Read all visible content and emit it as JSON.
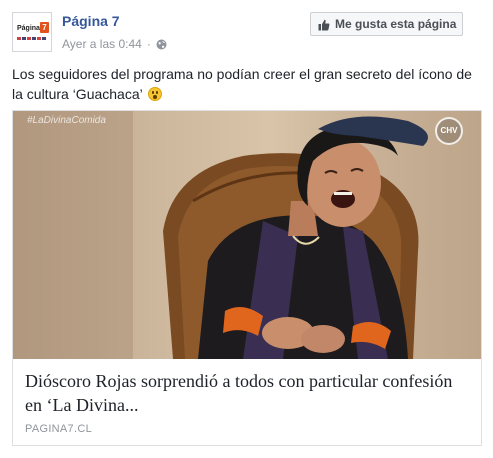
{
  "header": {
    "page_name": "Página 7",
    "timestamp": "Ayer a las 0:44",
    "separator": "·",
    "audience_icon": "globe-icon",
    "avatar_text": "Página",
    "avatar_badge": "7"
  },
  "like_button": {
    "label": "Me gusta esta página",
    "icon": "thumbs-up-icon"
  },
  "post": {
    "text": "Los seguidores del programa no podían creer el gran secreto del ícono de la cultura ‘Guachaca’",
    "emoji": "astonished-face-icon"
  },
  "link_card": {
    "watermark": "#LaDivinaComida",
    "channel_logo": "CHV",
    "title": "Dióscoro Rojas sorprendió a todos con particular confesión en ‘La Divina...",
    "domain": "PAGINA7.CL"
  },
  "colors": {
    "link_blue": "#365899",
    "meta_gray": "#90949c",
    "text": "#1d2129",
    "border": "#dddfe2"
  }
}
